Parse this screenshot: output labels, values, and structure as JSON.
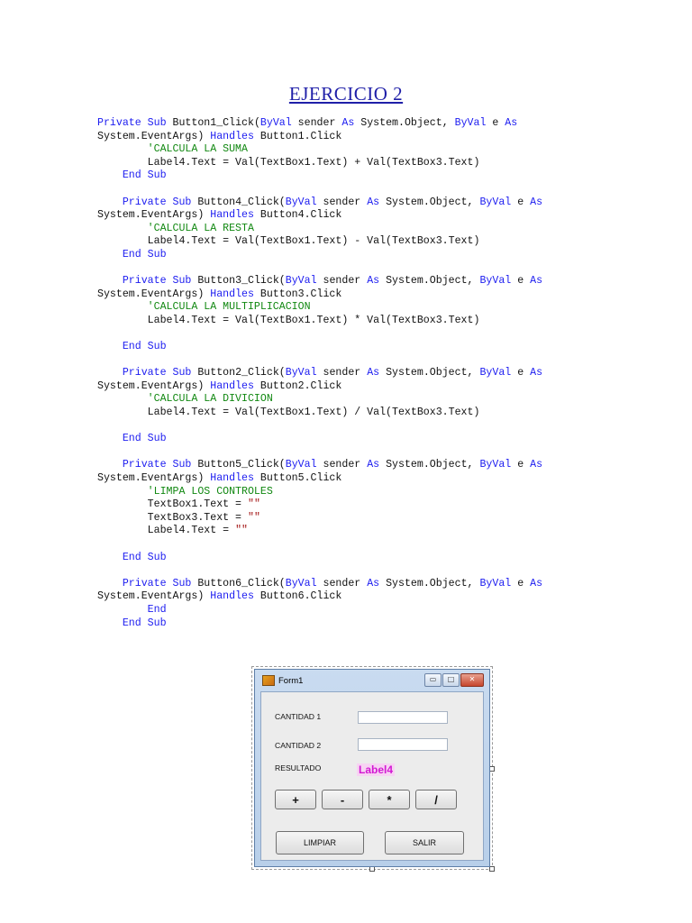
{
  "title": "EJERCICIO 2",
  "code_lines": [
    [
      {
        "t": "Private Sub ",
        "c": "kw"
      },
      {
        "t": "Button1_Click(",
        "c": "normal"
      },
      {
        "t": "ByVal",
        "c": "kw"
      },
      {
        "t": " sender ",
        "c": "normal"
      },
      {
        "t": "As",
        "c": "kw"
      },
      {
        "t": " System.Object, ",
        "c": "normal"
      },
      {
        "t": "ByVal",
        "c": "kw"
      },
      {
        "t": " e ",
        "c": "normal"
      },
      {
        "t": "As",
        "c": "kw"
      }
    ],
    [
      {
        "t": "System.EventArgs) ",
        "c": "normal"
      },
      {
        "t": "Handles",
        "c": "kw"
      },
      {
        "t": " Button1.Click",
        "c": "normal"
      }
    ],
    [
      {
        "t": "        'CALCULA LA SUMA",
        "c": "cm"
      }
    ],
    [
      {
        "t": "        Label4.Text = Val(TextBox1.Text) + Val(TextBox3.Text)",
        "c": "normal"
      }
    ],
    [
      {
        "t": "    ",
        "c": "normal"
      },
      {
        "t": "End Sub",
        "c": "kw"
      }
    ],
    [],
    [
      {
        "t": "    ",
        "c": "normal"
      },
      {
        "t": "Private Sub ",
        "c": "kw"
      },
      {
        "t": "Button4_Click(",
        "c": "normal"
      },
      {
        "t": "ByVal",
        "c": "kw"
      },
      {
        "t": " sender ",
        "c": "normal"
      },
      {
        "t": "As",
        "c": "kw"
      },
      {
        "t": " System.Object, ",
        "c": "normal"
      },
      {
        "t": "ByVal",
        "c": "kw"
      },
      {
        "t": " e ",
        "c": "normal"
      },
      {
        "t": "As",
        "c": "kw"
      }
    ],
    [
      {
        "t": "System.EventArgs) ",
        "c": "normal"
      },
      {
        "t": "Handles",
        "c": "kw"
      },
      {
        "t": " Button4.Click",
        "c": "normal"
      }
    ],
    [
      {
        "t": "        'CALCULA LA RESTA",
        "c": "cm"
      }
    ],
    [
      {
        "t": "        Label4.Text = Val(TextBox1.Text) - Val(TextBox3.Text)",
        "c": "normal"
      }
    ],
    [
      {
        "t": "    ",
        "c": "normal"
      },
      {
        "t": "End Sub",
        "c": "kw"
      }
    ],
    [],
    [
      {
        "t": "    ",
        "c": "normal"
      },
      {
        "t": "Private Sub ",
        "c": "kw"
      },
      {
        "t": "Button3_Click(",
        "c": "normal"
      },
      {
        "t": "ByVal",
        "c": "kw"
      },
      {
        "t": " sender ",
        "c": "normal"
      },
      {
        "t": "As",
        "c": "kw"
      },
      {
        "t": " System.Object, ",
        "c": "normal"
      },
      {
        "t": "ByVal",
        "c": "kw"
      },
      {
        "t": " e ",
        "c": "normal"
      },
      {
        "t": "As",
        "c": "kw"
      }
    ],
    [
      {
        "t": "System.EventArgs) ",
        "c": "normal"
      },
      {
        "t": "Handles",
        "c": "kw"
      },
      {
        "t": " Button3.Click",
        "c": "normal"
      }
    ],
    [
      {
        "t": "        'CALCULA LA MULTIPLICACION",
        "c": "cm"
      }
    ],
    [
      {
        "t": "        Label4.Text = Val(TextBox1.Text) * Val(TextBox3.Text)",
        "c": "normal"
      }
    ],
    [],
    [
      {
        "t": "    ",
        "c": "normal"
      },
      {
        "t": "End Sub",
        "c": "kw"
      }
    ],
    [],
    [
      {
        "t": "    ",
        "c": "normal"
      },
      {
        "t": "Private Sub ",
        "c": "kw"
      },
      {
        "t": "Button2_Click(",
        "c": "normal"
      },
      {
        "t": "ByVal",
        "c": "kw"
      },
      {
        "t": " sender ",
        "c": "normal"
      },
      {
        "t": "As",
        "c": "kw"
      },
      {
        "t": " System.Object, ",
        "c": "normal"
      },
      {
        "t": "ByVal",
        "c": "kw"
      },
      {
        "t": " e ",
        "c": "normal"
      },
      {
        "t": "As",
        "c": "kw"
      }
    ],
    [
      {
        "t": "System.EventArgs) ",
        "c": "normal"
      },
      {
        "t": "Handles",
        "c": "kw"
      },
      {
        "t": " Button2.Click",
        "c": "normal"
      }
    ],
    [
      {
        "t": "        'CALCULA LA DIVICION",
        "c": "cm"
      }
    ],
    [
      {
        "t": "        Label4.Text = Val(TextBox1.Text) / Val(TextBox3.Text)",
        "c": "normal"
      }
    ],
    [],
    [
      {
        "t": "    ",
        "c": "normal"
      },
      {
        "t": "End Sub",
        "c": "kw"
      }
    ],
    [],
    [
      {
        "t": "    ",
        "c": "normal"
      },
      {
        "t": "Private Sub ",
        "c": "kw"
      },
      {
        "t": "Button5_Click(",
        "c": "normal"
      },
      {
        "t": "ByVal",
        "c": "kw"
      },
      {
        "t": " sender ",
        "c": "normal"
      },
      {
        "t": "As",
        "c": "kw"
      },
      {
        "t": " System.Object, ",
        "c": "normal"
      },
      {
        "t": "ByVal",
        "c": "kw"
      },
      {
        "t": " e ",
        "c": "normal"
      },
      {
        "t": "As",
        "c": "kw"
      }
    ],
    [
      {
        "t": "System.EventArgs) ",
        "c": "normal"
      },
      {
        "t": "Handles",
        "c": "kw"
      },
      {
        "t": " Button5.Click",
        "c": "normal"
      }
    ],
    [
      {
        "t": "        'LIMPA LOS CONTROLES",
        "c": "cm"
      }
    ],
    [
      {
        "t": "        TextBox1.Text = ",
        "c": "normal"
      },
      {
        "t": "\"\"",
        "c": "st"
      }
    ],
    [
      {
        "t": "        TextBox3.Text = ",
        "c": "normal"
      },
      {
        "t": "\"\"",
        "c": "st"
      }
    ],
    [
      {
        "t": "        Label4.Text = ",
        "c": "normal"
      },
      {
        "t": "\"\"",
        "c": "st"
      }
    ],
    [],
    [
      {
        "t": "    ",
        "c": "normal"
      },
      {
        "t": "End Sub",
        "c": "kw"
      }
    ],
    [],
    [
      {
        "t": "    ",
        "c": "normal"
      },
      {
        "t": "Private Sub ",
        "c": "kw"
      },
      {
        "t": "Button6_Click(",
        "c": "normal"
      },
      {
        "t": "ByVal",
        "c": "kw"
      },
      {
        "t": " sender ",
        "c": "normal"
      },
      {
        "t": "As",
        "c": "kw"
      },
      {
        "t": " System.Object, ",
        "c": "normal"
      },
      {
        "t": "ByVal",
        "c": "kw"
      },
      {
        "t": " e ",
        "c": "normal"
      },
      {
        "t": "As",
        "c": "kw"
      }
    ],
    [
      {
        "t": "System.EventArgs) ",
        "c": "normal"
      },
      {
        "t": "Handles",
        "c": "kw"
      },
      {
        "t": " Button6.Click",
        "c": "normal"
      }
    ],
    [
      {
        "t": "        ",
        "c": "normal"
      },
      {
        "t": "End",
        "c": "kw"
      }
    ],
    [
      {
        "t": "    ",
        "c": "normal"
      },
      {
        "t": "End Sub",
        "c": "kw"
      }
    ]
  ],
  "form": {
    "title": "Form1",
    "min_glyph": "▭",
    "max_glyph": "□",
    "close_glyph": "✕",
    "lbl_cantidad1": "CANTIDAD 1",
    "lbl_cantidad2": "CANTIDAD 2",
    "lbl_resultado": "RESULTADO",
    "label4": "Label4",
    "btn_add": "+",
    "btn_sub": "-",
    "btn_mul": "*",
    "btn_div": "/",
    "btn_limpiar": "LIMPIAR",
    "btn_salir": "SALIR"
  },
  "colors": {
    "keyword": "#1c1cf0",
    "comment": "#118811",
    "string": "#a31515",
    "title": "#1f1fa8",
    "label4": "#d218d2"
  }
}
